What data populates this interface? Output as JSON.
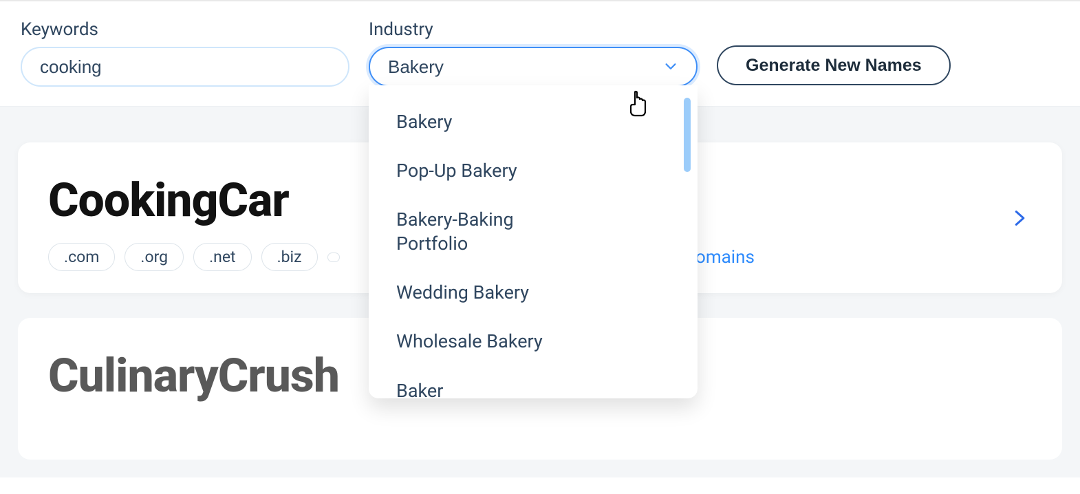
{
  "controls": {
    "keywords_label": "Keywords",
    "keywords_value": "cooking",
    "industry_label": "Industry",
    "industry_value": "Bakery",
    "generate_label": "Generate New Names"
  },
  "dropdown": {
    "items": [
      "Bakery",
      "Pop-Up Bakery",
      "Bakery-Baking Portfolio",
      "Wedding Bakery",
      "Wholesale Bakery",
      "Baker"
    ]
  },
  "results": [
    {
      "name": "CookingCar",
      "style": "black",
      "extensions": [
        ".com",
        ".org",
        ".net",
        ".biz"
      ],
      "more_label": "re domains",
      "show_extensions": true
    },
    {
      "name": "CulinaryCrush",
      "style": "gray",
      "extensions": [],
      "more_label": "",
      "show_extensions": false
    }
  ]
}
